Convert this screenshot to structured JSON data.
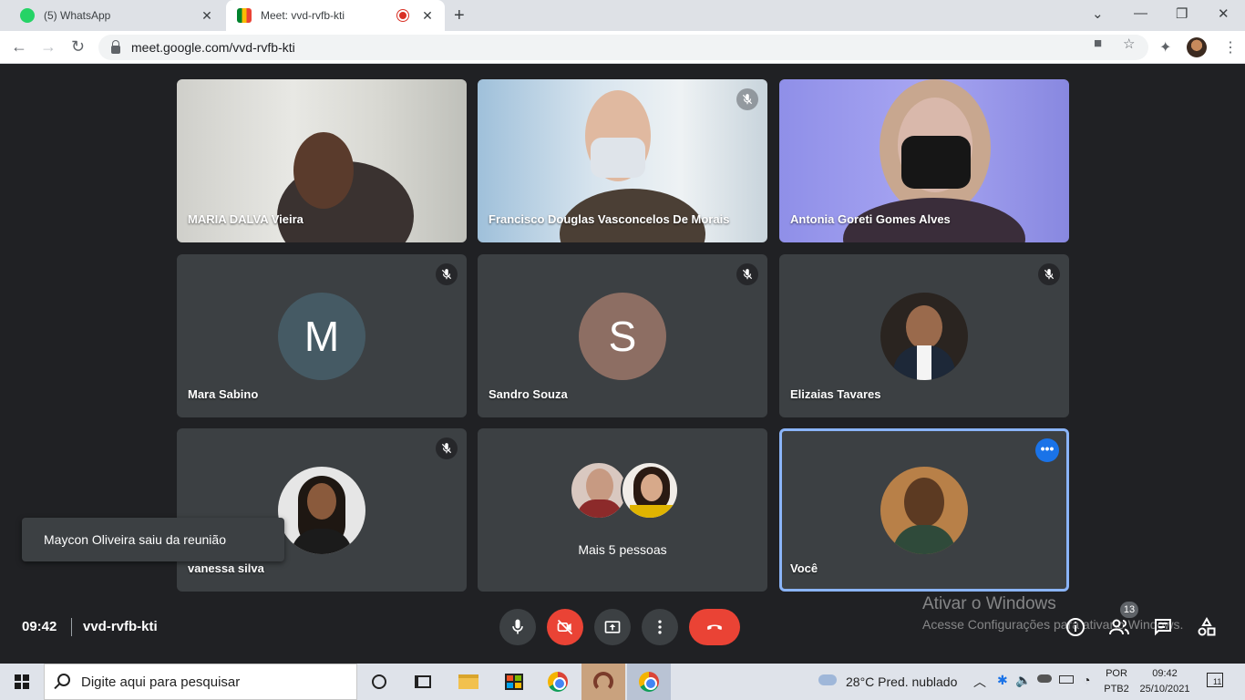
{
  "browser": {
    "tabs": [
      {
        "title": "(5) WhatsApp",
        "close": "✕"
      },
      {
        "title": "Meet: vvd-rvfb-kti",
        "close": "✕"
      }
    ],
    "new_tab": "+",
    "window_controls": {
      "minimize": "—",
      "restore": "❐",
      "close": "✕",
      "tab_search": "⌄"
    },
    "url": "meet.google.com/vvd-rvfb-kti"
  },
  "meet": {
    "tiles": [
      {
        "name": "MARIA DALVA Vieira",
        "type": "video"
      },
      {
        "name": "Francisco Douglas Vasconcelos De Morais",
        "type": "video",
        "muted": true
      },
      {
        "name": "Antonia Goreti Gomes Alves",
        "type": "video"
      },
      {
        "name": "Mara Sabino",
        "type": "avatar",
        "initial": "M",
        "color": "#455a64",
        "muted": true
      },
      {
        "name": "Sandro Souza",
        "type": "avatar",
        "initial": "S",
        "color": "#8d6e63",
        "muted": true
      },
      {
        "name": "Elizaias Tavares",
        "type": "photo",
        "muted": true
      },
      {
        "name": "vanessa silva",
        "type": "photo",
        "muted": true
      },
      {
        "name": "Mais 5 pessoas",
        "type": "group"
      },
      {
        "name": "Você",
        "type": "photo",
        "self": true
      }
    ],
    "toast": "Maycon Oliveira saiu da reunião",
    "time": "09:42",
    "meeting_code": "vvd-rvfb-kti",
    "participants_count": "13",
    "more_icon": "•••"
  },
  "watermark": {
    "line1": "Ativar o Windows",
    "line2": "Acesse Configurações para ativar o Windows."
  },
  "taskbar": {
    "search_placeholder": "Digite aqui para pesquisar",
    "weather": "28°C  Pred. nublado",
    "lang_top": "POR",
    "lang_bottom": "PTB2",
    "clock_time": "09:42",
    "clock_date": "25/10/2021",
    "notifications": "11"
  },
  "colors": {
    "meet_bg": "#202124",
    "tile_bg": "#3c4043",
    "hangup": "#ea4335",
    "accent": "#1a73e8"
  }
}
